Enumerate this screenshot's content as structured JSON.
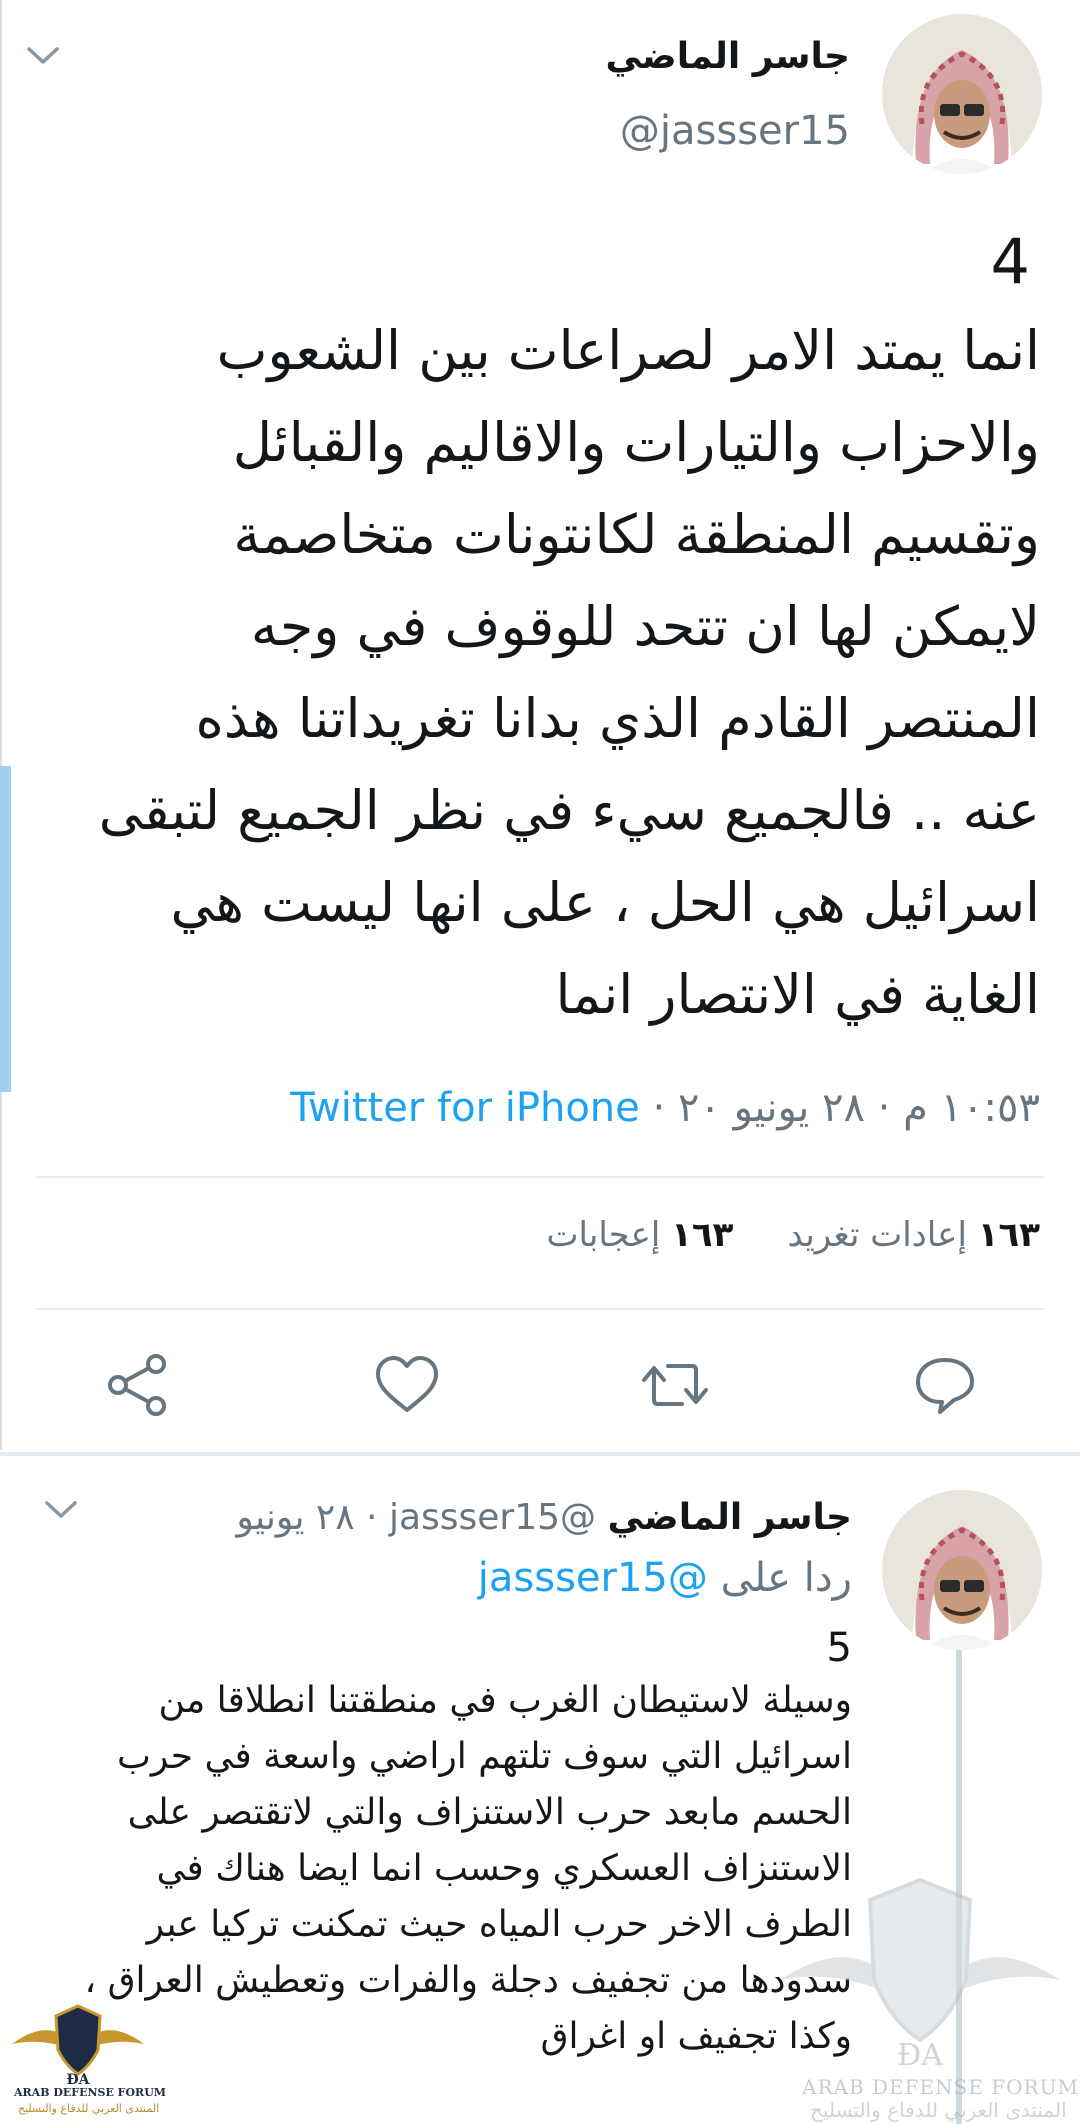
{
  "main_tweet": {
    "author_name": "جاسر الماضي",
    "handle": "@jassser15",
    "number": "4",
    "lines": [
      "انما يمتد الامر لصراعات بين الشعوب",
      "والاحزاب والتيارات والاقاليم والقبائل",
      "وتقسيم المنطقة لكانتونات متخاصمة",
      "لايمكن لها ان تتحد للوقوف في وجه",
      "المنتصر القادم الذي بدانا تغريداتنا هذه",
      "عنه .. فالجميع سيء في نظر الجميع لتبقى",
      "اسرائيل هي الحل ، على انها ليست هي",
      "الغاية في الانتصار انما"
    ],
    "time": "١٠:٥٣ م",
    "date": "٢٨ يونيو ٢٠",
    "source": "Twitter for iPhone",
    "retweets_count": "١٦٣",
    "retweets_label": "إعادات تغريد",
    "likes_count": "١٦٣",
    "likes_label": "إعجابات"
  },
  "actions": [
    "reply-icon",
    "retweet-icon",
    "like-icon",
    "share-icon"
  ],
  "reply_tweet": {
    "author_name": "جاسر الماضي",
    "handle": "@jassser15",
    "date": "٢٨ يونيو",
    "reply_label": "ردا على",
    "reply_mention": "@jassser15",
    "number": "5",
    "lines": [
      "وسيلة لاستيطان الغرب في منطقتنا انطلاقا من",
      "اسرائيل التي سوف تلتهم اراضي واسعة في حرب",
      "الحسم مابعد حرب الاستنزاف والتي لاتقتصر على",
      "الاستنزاف العسكري وحسب انما ايضا هناك في",
      "الطرف الاخر حرب المياه حيث تمكنت تركيا عبر",
      "سدودها من تجفيف دجلة والفرات وتعطيش العراق ،",
      "وكذا تجفيف او اغراق"
    ]
  },
  "watermark": {
    "mark": "ĐA",
    "name": "ARAB DEFENSE FORUM",
    "arabic": "المنتدى العربي للدفاع والتسليح"
  },
  "colors": {
    "link": "#1da1f2",
    "secondary": "#66757f",
    "accent_bar": "#9fd0f0"
  }
}
